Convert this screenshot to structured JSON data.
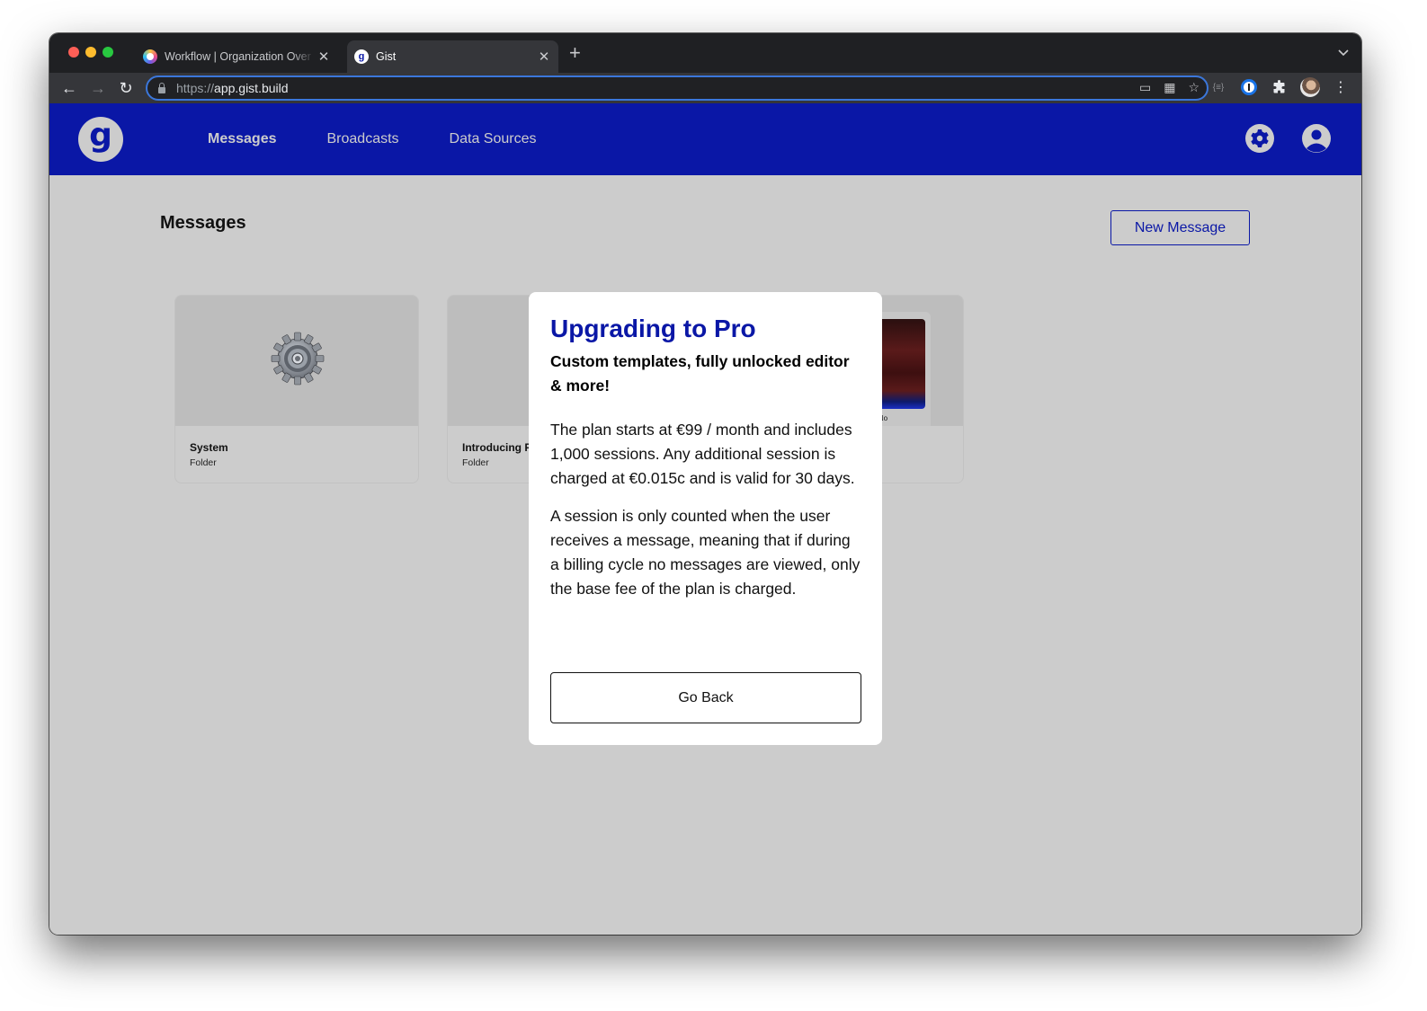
{
  "browser": {
    "tabs": [
      {
        "title": "Workflow | Organization Over Life",
        "active": false
      },
      {
        "title": "Gist",
        "active": true
      }
    ],
    "address_bar": {
      "scheme": "https://",
      "host": "app.gist.build"
    },
    "icons": {
      "back": "arrow-left-icon",
      "forward": "arrow-right-icon",
      "reload": "reload-icon",
      "lock": "lock-icon",
      "cast": "cast-icon",
      "qr": "qr-code-icon",
      "bookmark": "star-icon",
      "extensions": "puzzle-icon"
    },
    "glyphs": {
      "close": "✕",
      "new_tab": "+",
      "tab_menu": "⌄",
      "back": "←",
      "forward": "→",
      "reload": "↻",
      "cast": "▭",
      "qr": "▦",
      "star": "☆",
      "ext_json": "{≡}",
      "puzzle": "✚",
      "more": "⋮"
    }
  },
  "app": {
    "logo_letter": "g",
    "brand_color": "#0a17a6",
    "nav": [
      {
        "label": "Messages",
        "active": true
      },
      {
        "label": "Broadcasts",
        "active": false
      },
      {
        "label": "Data Sources",
        "active": false
      }
    ]
  },
  "main": {
    "title": "Messages",
    "new_message_label": "New Message",
    "cards": [
      {
        "name": "System",
        "type": "Folder"
      },
      {
        "name": "Introducing Pro",
        "type": "Folder"
      },
      {
        "name": "",
        "type": "",
        "preview_caption": "soon. No"
      }
    ]
  },
  "modal": {
    "title": "Upgrading to Pro",
    "subtitle": "Custom templates, fully unlocked editor & more!",
    "paragraphs": [
      "The plan starts at €99 / month and includes 1,000 sessions. Any additional session is charged at €0.015c and is valid for 30 days.",
      "A session is only counted when the user receives a message, meaning that if during a billing cycle no messages are viewed, only the base fee of the plan is charged."
    ],
    "go_back_label": "Go Back"
  }
}
